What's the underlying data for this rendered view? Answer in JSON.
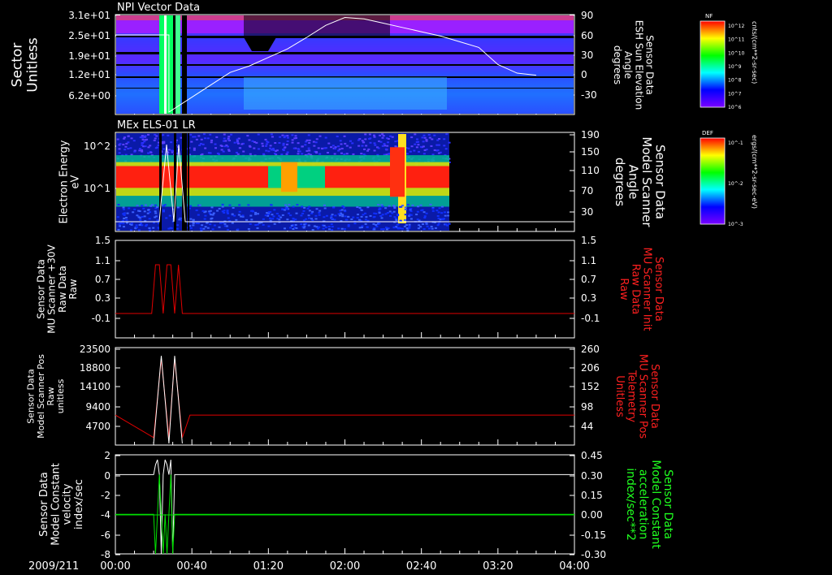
{
  "time_axis": {
    "date": "2009/211",
    "ticks": [
      "00:00",
      "00:40",
      "01:20",
      "02:00",
      "02:40",
      "03:20",
      "04:00"
    ]
  },
  "colorbars": [
    {
      "tag": "NF",
      "units": "cnts/(cm**2-sr-sec)",
      "tick_labels": [
        "10^12",
        "10^11",
        "10^10",
        "10^9",
        "10^8",
        "10^7",
        "10^6"
      ]
    },
    {
      "tag": "DEF",
      "units": "ergs/(cm**2-sr-sec-eV)",
      "tick_labels": [
        "10^-1",
        "10^-2",
        "10^-3"
      ]
    }
  ],
  "chart_data": [
    {
      "type": "heatmap",
      "title": "NPI Vector Data",
      "ylabel": [
        "Sector",
        "Unitless"
      ],
      "yticks": [
        "3.1e+01",
        "2.5e+01",
        "1.9e+01",
        "1.2e+01",
        "6.2e+00"
      ],
      "right_ylabel": [
        "Sensor Data",
        "ESH Sun Elevation",
        "Angle",
        "degrees"
      ],
      "right_yticks": [
        "90",
        "60",
        "30",
        "0",
        "-30"
      ],
      "right_ylim": [
        -50,
        90
      ],
      "overlay_series": [
        {
          "x_min": [
            0,
            10,
            20,
            30,
            40,
            50,
            60,
            70,
            80,
            90,
            100,
            110,
            120,
            130,
            140,
            150,
            160
          ],
          "y": [
            9,
            18,
            30,
            42,
            58,
            75,
            86,
            84,
            78,
            72,
            66,
            60,
            52,
            44,
            20,
            8,
            5
          ]
        }
      ]
    },
    {
      "type": "heatmap",
      "title": "MEx ELS-01 LR",
      "ylabel": [
        "Electron Energy",
        "eV"
      ],
      "yticks": [
        "10^2",
        "10^1"
      ],
      "right_ylabel": [
        "Sensor Data",
        "Model Scanner",
        "Angle",
        "degrees"
      ],
      "right_yticks": [
        "190",
        "150",
        "110",
        "70",
        "30"
      ],
      "right_ylim": [
        0,
        190
      ]
    },
    {
      "type": "line",
      "ylabel": [
        "Sensor Data",
        "MU Scanner +30V",
        "Raw Data",
        "Raw"
      ],
      "yticks": [
        "1.5",
        "1.1",
        "0.7",
        "0.3",
        "-0.1"
      ],
      "ylim": [
        -0.5,
        1.5
      ],
      "right_ylabel": [
        "Sensor Data",
        "MU Scanner Init",
        "Raw Data",
        "Raw"
      ],
      "right_yticks": [
        "1.5",
        "1.1",
        "0.7",
        "0.3",
        "-0.1"
      ],
      "series": [
        {
          "color": "#e00000",
          "x_min": [
            0,
            19,
            21,
            23,
            25,
            27,
            29,
            31,
            33,
            35,
            240
          ],
          "y": [
            0,
            0,
            1,
            1,
            0,
            1,
            1,
            0,
            1,
            0,
            0
          ]
        }
      ]
    },
    {
      "type": "line",
      "ylabel": [
        "Sensor Data",
        "Model Scanner Pos",
        "Raw",
        "unitless"
      ],
      "yticks": [
        "23500",
        "18800",
        "14100",
        "9400",
        "4700"
      ],
      "ylim": [
        0,
        23500
      ],
      "right_ylabel": [
        "Sensor Data",
        "MU Scanner Pos",
        "Telemetry",
        "Unitless"
      ],
      "right_yticks": [
        "260",
        "206",
        "152",
        "98",
        "44"
      ],
      "right_ylim": [
        0,
        260
      ],
      "series": [
        {
          "color": "#e00000",
          "x_min": [
            0,
            20,
            24,
            28,
            31,
            35,
            39,
            240
          ],
          "y": [
            80,
            20,
            230,
            20,
            230,
            20,
            80,
            80
          ],
          "axis": "right"
        },
        {
          "color": "#ffffff",
          "x_min": [
            20,
            24,
            28,
            31,
            35
          ],
          "y": [
            0,
            21500,
            0,
            21500,
            0
          ],
          "axis": "left"
        }
      ]
    },
    {
      "type": "line",
      "ylabel": [
        "Sensor Data",
        "Model Constant",
        "velocity",
        "index/sec"
      ],
      "yticks": [
        "2",
        "0",
        "-2",
        "-4",
        "-6",
        "-8"
      ],
      "ylim": [
        -8,
        2
      ],
      "right_ylabel": [
        "Sensor Data",
        "Model Constant",
        "acceleration",
        "index/sec**2"
      ],
      "right_yticks": [
        "0.45",
        "0.30",
        "0.15",
        "0.00",
        "-0.15",
        "-0.30"
      ],
      "right_ylim": [
        -0.3,
        0.45
      ],
      "series": [
        {
          "color": "#ffffff",
          "x_min": [
            0,
            20,
            21,
            22,
            23,
            24,
            25,
            26,
            27,
            28,
            29,
            30,
            31,
            240
          ],
          "y": [
            0,
            0,
            1,
            1.5,
            0,
            -8,
            0,
            1.5,
            1,
            0,
            1.5,
            -8,
            0,
            0
          ],
          "axis": "left"
        },
        {
          "color": "#00e000",
          "x_min": [
            0,
            20,
            21,
            22,
            23,
            24,
            25,
            26,
            27,
            28,
            29,
            30,
            31,
            240
          ],
          "y": [
            0,
            0,
            -0.3,
            0,
            0.3,
            0,
            -0.3,
            0,
            -0.3,
            0,
            0.3,
            -0.3,
            0,
            0
          ],
          "axis": "right"
        }
      ]
    }
  ],
  "colors": {
    "label": "#ffffff",
    "red_label": "#ff2020",
    "green_label": "#20ff20"
  }
}
